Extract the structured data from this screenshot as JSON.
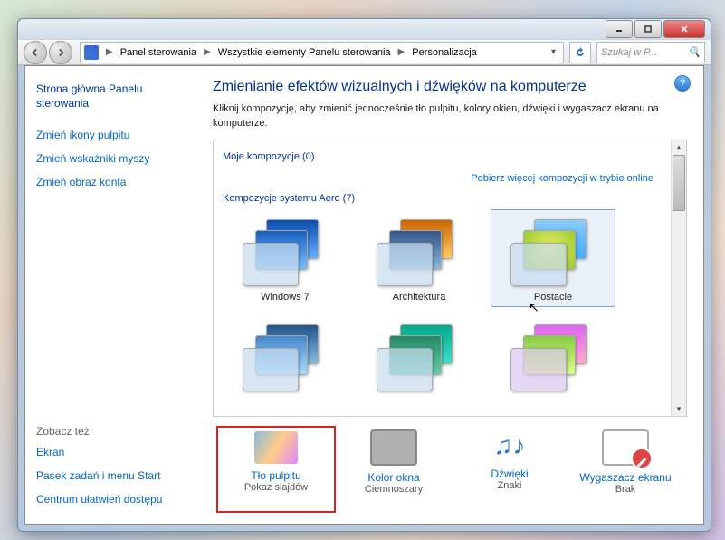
{
  "breadcrumb": {
    "items": [
      "Panel sterowania",
      "Wszystkie elementy Panelu sterowania",
      "Personalizacja"
    ]
  },
  "search": {
    "placeholder": "Szukaj w P..."
  },
  "sidebar": {
    "home": "Strona główna Panelu sterowania",
    "links": [
      "Zmień ikony pulpitu",
      "Zmień wskaźniki myszy",
      "Zmień obraz konta"
    ],
    "see_also_label": "Zobacz też",
    "see_also": [
      "Ekran",
      "Pasek zadań i menu Start",
      "Centrum ułatwień dostępu"
    ]
  },
  "main": {
    "heading": "Zmienianie efektów wizualnych i dźwięków na komputerze",
    "desc": "Kliknij kompozycję, aby zmienić jednocześnie tło pulpitu, kolory okien, dźwięki i wygaszacz ekranu na komputerze.",
    "my_themes_label": "Moje kompozycje (0)",
    "online_link": "Pobierz więcej kompozycji w trybie online",
    "aero_label": "Kompozycje systemu Aero (7)",
    "themes_row1": [
      {
        "label": "Windows 7"
      },
      {
        "label": "Architektura"
      },
      {
        "label": "Postacie"
      }
    ]
  },
  "bottom": {
    "items": [
      {
        "title": "Tło pulpitu",
        "subtitle": "Pokaz slajdów"
      },
      {
        "title": "Kolor okna",
        "subtitle": "Ciemnoszary"
      },
      {
        "title": "Dźwięki",
        "subtitle": "Znaki"
      },
      {
        "title": "Wygaszacz ekranu",
        "subtitle": "Brak"
      }
    ]
  }
}
